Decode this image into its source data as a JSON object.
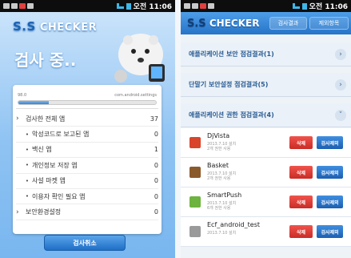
{
  "left": {
    "status": {
      "time": "오전 11:06"
    },
    "logo": {
      "prefix": "S.S",
      "text": "CHECKER"
    },
    "title": "검사 중..",
    "scan": {
      "left_text": "98.0",
      "right_text": "com.android.settings",
      "progress_fraction": 0.22
    },
    "results": [
      {
        "label": "검사한 전체 앱",
        "value": "37",
        "sub": false
      },
      {
        "label": "악성코드로 보고된 앱",
        "value": "0",
        "sub": true
      },
      {
        "label": "백신 앱",
        "value": "1",
        "sub": true
      },
      {
        "label": "개인정보 저장 앱",
        "value": "0",
        "sub": true
      },
      {
        "label": "사설 마켓 앱",
        "value": "0",
        "sub": true
      },
      {
        "label": "이용자 확인 필요 앱",
        "value": "0",
        "sub": true
      },
      {
        "label": "보안환경설정",
        "value": "0",
        "sub": false
      }
    ],
    "cancel_label": "검사취소"
  },
  "right": {
    "status": {
      "time": "오전 11:06"
    },
    "logo": {
      "prefix": "S.S",
      "text": "CHECKER"
    },
    "tabs": {
      "results": "검사결과",
      "remove": "제외항목"
    },
    "sections": [
      {
        "label": "애플리케이션 보안 점검결과(1)",
        "chev": "›"
      },
      {
        "label": "단말기 보안설정 점검결과(5)",
        "chev": "›"
      },
      {
        "label": "애플리케이션 권한 점검결과(4)",
        "chev": "˅"
      }
    ],
    "apps": [
      {
        "name": "DjVista",
        "meta1": "2013.7.10 설치",
        "meta2": "2개 권한 사용",
        "del": "삭제",
        "check": "검사제외",
        "icon_color": "#d9452b"
      },
      {
        "name": "Basket",
        "meta1": "2013.7.10 설치",
        "meta2": "2개 권한 사용",
        "del": "삭제",
        "check": "검사제외",
        "icon_color": "#8b5a2b"
      },
      {
        "name": "SmartPush",
        "meta1": "2013.7.10 설치",
        "meta2": "6개 권한 사용",
        "del": "삭제",
        "check": "검사제외",
        "icon_color": "#6db33f"
      },
      {
        "name": "Ecf_android_test",
        "meta1": "2013.7.10 설치",
        "meta2": "",
        "del": "삭제",
        "check": "검사제외",
        "icon_color": "#9a9a9a"
      }
    ]
  }
}
